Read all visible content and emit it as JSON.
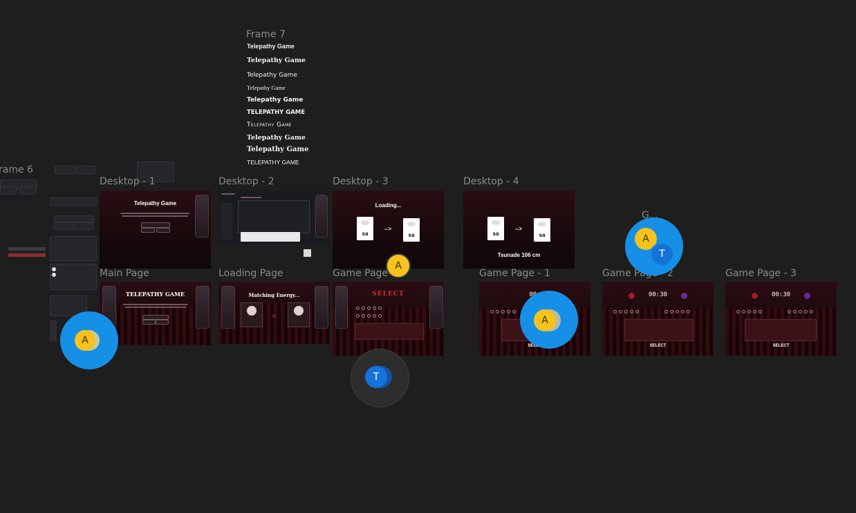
{
  "frame7": {
    "label": "Frame 7",
    "fonts": [
      "Telepathy Game",
      "Telepathy Game",
      "Telepathy Game",
      "Telepathy Game",
      "Telepathy Game",
      "TELEPATHY GAME",
      "Telepathy Game",
      "Telepathy Game",
      "Telepathy Game",
      "TELEPATHY GAME"
    ]
  },
  "frame6": {
    "label": "rame 6"
  },
  "frames": {
    "desktop1": {
      "label": "Desktop - 1",
      "title": "Telepathy Game"
    },
    "desktop2": {
      "label": "Desktop - 2"
    },
    "desktop3": {
      "label": "Desktop - 3",
      "loading": "Loading...",
      "card_left": "sa",
      "card_right": "sa",
      "arrow": "-->"
    },
    "desktop4": {
      "label": "Desktop - 4",
      "card_left": "sa",
      "card_right": "sa",
      "arrow": "-->",
      "result": "Tsunade 106 cm"
    },
    "main_page": {
      "label": "Main Page",
      "title": "TELEPATHY GAME"
    },
    "loading_page": {
      "label": "Loading Page",
      "title": "Matching Energy..."
    },
    "game_page": {
      "label": "Game Page",
      "title": "SELECT"
    },
    "game_page_1": {
      "label": "Game Page - 1",
      "timer": "00:",
      "select": "SELEC"
    },
    "game_page_2": {
      "label": "Game Page - 2",
      "timer": "00:30",
      "select": "SELECT"
    },
    "game_page_3": {
      "label": "Game Page - 3",
      "timer": "00:30",
      "select": "SELECT"
    },
    "offscreen_label": "G..."
  },
  "cursors": [
    {
      "avatar": "A"
    },
    {
      "avatar": "A"
    },
    {
      "avatar": "T"
    },
    {
      "avatar": "A"
    },
    {
      "avatar": "A"
    },
    {
      "avatar": "T"
    }
  ],
  "colors": {
    "canvas": "#1e1e1e",
    "cursor_blue": "#1590e6",
    "avatar_yellow": "#f7c21c",
    "avatar_blue": "#1473d8",
    "frame_red": "#2a0d12"
  }
}
